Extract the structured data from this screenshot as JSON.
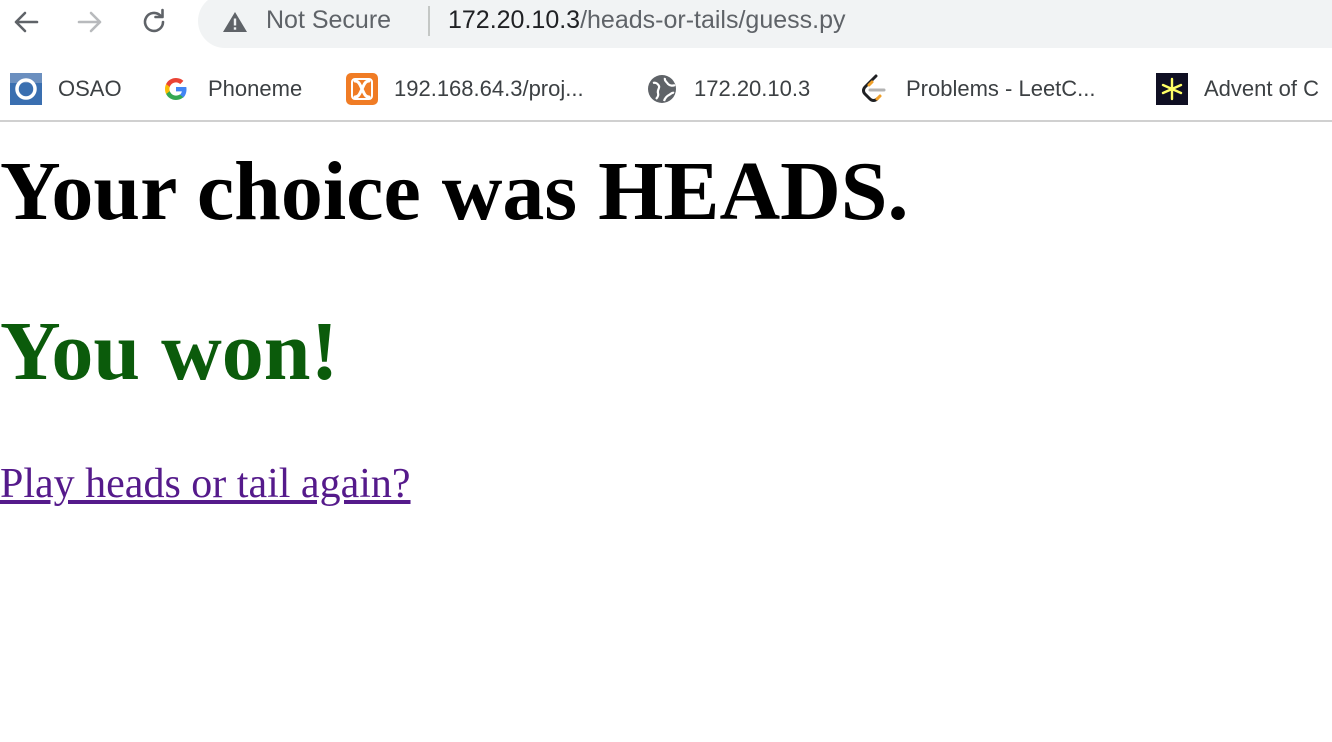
{
  "browser": {
    "security_label": "Not Secure",
    "url_host": "172.20.10.3",
    "url_path": "/heads-or-tails/guess.py",
    "bookmarks": [
      {
        "label": "OSAO",
        "icon": "osao-icon"
      },
      {
        "label": "Phoneme",
        "icon": "google-icon"
      },
      {
        "label": "192.168.64.3/proj...",
        "icon": "xampp-icon"
      },
      {
        "label": "172.20.10.3",
        "icon": "globe-icon"
      },
      {
        "label": "Problems - LeetC...",
        "icon": "leetcode-icon"
      },
      {
        "label": "Advent of C",
        "icon": "advent-star-icon"
      }
    ]
  },
  "page": {
    "choice_text": "Your choice was HEADS.",
    "result_text": "You won!",
    "play_again_link": "Play heads or tail again?"
  },
  "colors": {
    "result": "#0b5b0b",
    "visited_link": "#551a8b"
  }
}
